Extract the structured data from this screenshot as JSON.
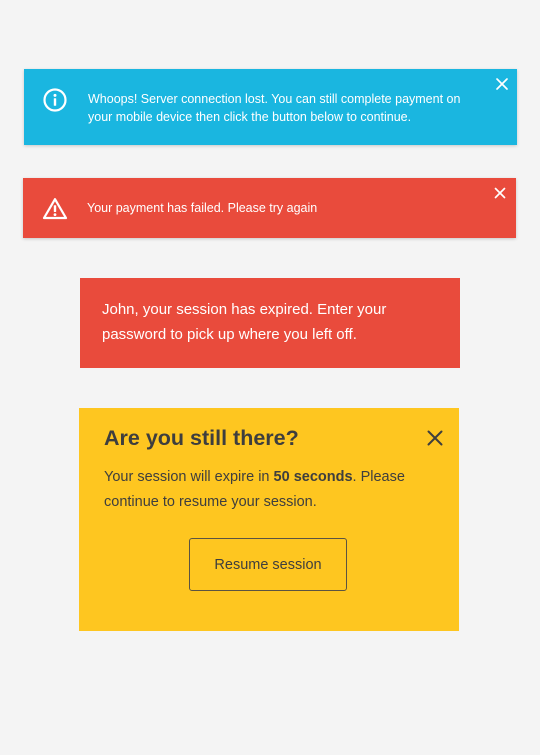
{
  "info_toast": {
    "icon": "info-circle-icon",
    "message": "Whoops! Server connection lost. You can still complete payment on your mobile device then click the button below to continue.",
    "close_icon": "close-icon",
    "color": "#1ab6e0"
  },
  "error_toast": {
    "icon": "warning-triangle-icon",
    "message": "Your payment has failed. Please try again",
    "close_icon": "close-icon",
    "color": "#e94b3c"
  },
  "session_expired": {
    "message": "John, your session has expired. Enter your password to pick up where you left off.",
    "color": "#e94b3c"
  },
  "still_there": {
    "title": "Are you still there?",
    "body_prefix": "Your session will expire in ",
    "countdown": "50 seconds",
    "body_suffix": ". Please continue to resume your session.",
    "button_label": "Resume session",
    "close_icon": "close-icon",
    "color": "#fec620"
  }
}
